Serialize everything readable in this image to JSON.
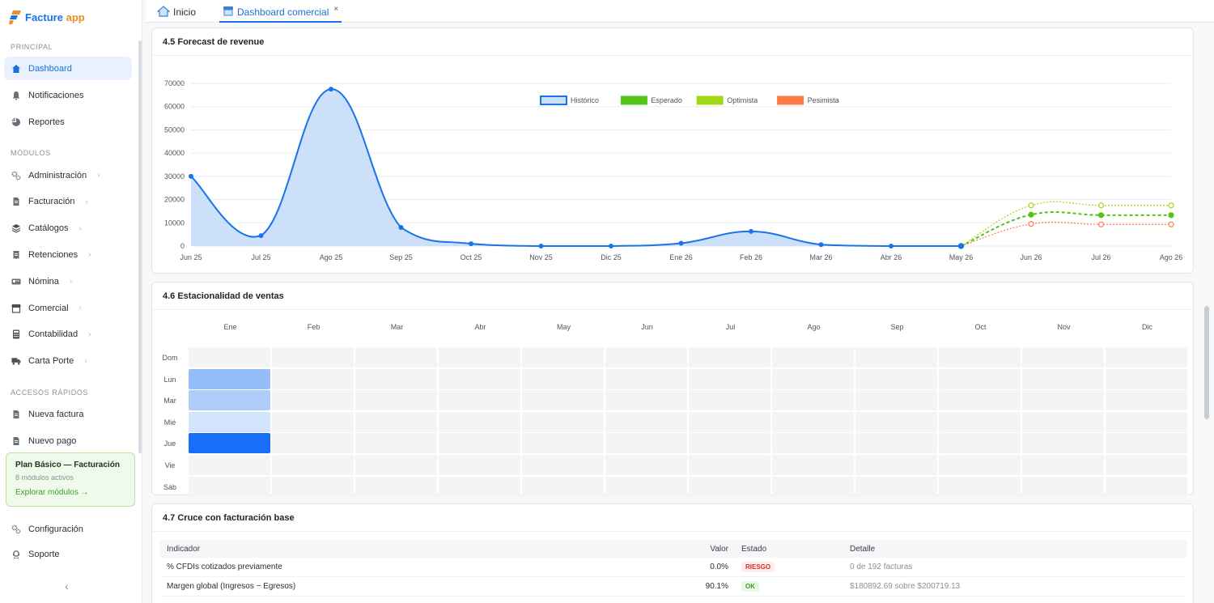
{
  "brand": {
    "name": "Facture",
    "suffix": "app"
  },
  "sidebar": {
    "principal_label": "PRINCIPAL",
    "principal": [
      {
        "label": "Dashboard",
        "icon": "home-icon",
        "active": true
      },
      {
        "label": "Notificaciones",
        "icon": "bell-icon"
      },
      {
        "label": "Reportes",
        "icon": "pie-chart-icon"
      }
    ],
    "modulos_label": "MÓDULOS",
    "modulos": [
      {
        "label": "Administración",
        "icon": "gears-icon"
      },
      {
        "label": "Facturación",
        "icon": "document-icon"
      },
      {
        "label": "Catálogos",
        "icon": "layers-icon"
      },
      {
        "label": "Retenciones",
        "icon": "receipt-icon"
      },
      {
        "label": "Nómina",
        "icon": "id-card-icon"
      },
      {
        "label": "Comercial",
        "icon": "store-icon"
      },
      {
        "label": "Contabilidad",
        "icon": "calculator-icon"
      },
      {
        "label": "Carta Porte",
        "icon": "truck-icon"
      }
    ],
    "accesos_label": "ACCESOS RÁPIDOS",
    "accesos": [
      {
        "label": "Nueva factura",
        "icon": "document-icon"
      },
      {
        "label": "Nuevo pago",
        "icon": "document-icon"
      }
    ],
    "plan": {
      "title": "Plan Básico — Facturación",
      "subtitle": "8 módulos activos",
      "link": "Explorar módulos →"
    },
    "footer": [
      {
        "label": "Configuración",
        "icon": "gears-icon"
      },
      {
        "label": "Soporte",
        "icon": "headset-icon"
      }
    ],
    "collapse_glyph": "‹"
  },
  "tabs": [
    {
      "label": "Inicio",
      "icon": "home-icon"
    },
    {
      "label": "Dashboard comercial",
      "icon": "store-icon",
      "active": true,
      "close": "×"
    }
  ],
  "forecast": {
    "title": "4.5 Forecast de revenue",
    "chart_data": {
      "type": "line",
      "categories": [
        "Jun 25",
        "Jul 25",
        "Ago 25",
        "Sep 25",
        "Oct 25",
        "Nov 25",
        "Dic 25",
        "Ene 26",
        "Feb 26",
        "Mar 26",
        "Abr 26",
        "May 26",
        "Jun 26",
        "Jul 26",
        "Ago 26"
      ],
      "ylim": [
        0,
        70000
      ],
      "yticks": [
        0,
        10000,
        20000,
        30000,
        40000,
        50000,
        60000,
        70000
      ],
      "legend": "top-center",
      "grid": true,
      "series": [
        {
          "name": "Histórico",
          "color": "#1a73e8",
          "fill": "#cce0fa",
          "values": [
            30000,
            4500,
            67500,
            8000,
            1000,
            0,
            0,
            1200,
            6300,
            600,
            0,
            0,
            null,
            null,
            null
          ]
        },
        {
          "name": "Esperado",
          "color": "#52c41a",
          "dash": true,
          "values": [
            null,
            null,
            null,
            null,
            null,
            null,
            null,
            null,
            null,
            null,
            null,
            0,
            13500,
            13300,
            13300
          ]
        },
        {
          "name": "Optimista",
          "color": "#a0d911",
          "dash": true,
          "values": [
            null,
            null,
            null,
            null,
            null,
            null,
            null,
            null,
            null,
            null,
            null,
            0,
            17500,
            17500,
            17500
          ]
        },
        {
          "name": "Pesimista",
          "color": "#ff7a45",
          "dash": true,
          "values": [
            null,
            null,
            null,
            null,
            null,
            null,
            null,
            null,
            null,
            null,
            null,
            0,
            9500,
            9300,
            9300
          ]
        }
      ]
    }
  },
  "seasonality": {
    "title": "4.6 Estacionalidad de ventas",
    "chart_data": {
      "type": "heatmap",
      "months": [
        "Ene",
        "Feb",
        "Mar",
        "Abr",
        "May",
        "Jun",
        "Jul",
        "Ago",
        "Sep",
        "Oct",
        "Nov",
        "Dic"
      ],
      "days": [
        "Dom",
        "Lun",
        "Mar",
        "Mié",
        "Jue",
        "Vie",
        "Sáb"
      ],
      "values": [
        [
          0,
          0,
          0,
          0,
          0,
          0,
          0,
          0,
          0,
          0,
          0,
          0
        ],
        [
          0.4,
          0,
          0,
          0,
          0,
          0,
          0,
          0,
          0,
          0,
          0,
          0
        ],
        [
          0.28,
          0,
          0,
          0,
          0,
          0,
          0,
          0,
          0,
          0,
          0,
          0
        ],
        [
          0.1,
          0,
          0,
          0,
          0,
          0,
          0,
          0,
          0,
          0,
          0,
          0
        ],
        [
          1,
          0,
          0,
          0,
          0,
          0,
          0,
          0,
          0,
          0,
          0,
          0
        ],
        [
          0,
          0,
          0,
          0,
          0,
          0,
          0,
          0,
          0,
          0,
          0,
          0
        ],
        [
          0,
          0,
          0,
          0,
          0,
          0,
          0,
          0,
          0,
          0,
          0,
          0
        ]
      ]
    }
  },
  "cruce": {
    "title": "4.7 Cruce con facturación base",
    "headers": {
      "indicador": "Indicador",
      "valor": "Valor",
      "estado": "Estado",
      "detalle": "Detalle"
    },
    "rows": [
      {
        "indicador": "% CFDIs cotizados previamente",
        "valor": "0.0%",
        "estado": "RIESGO",
        "estado_kind": "riesgo",
        "detalle": "0 de 192 facturas"
      },
      {
        "indicador": "Margen global (Ingresos − Egresos)",
        "valor": "90.1%",
        "estado": "OK",
        "estado_kind": "ok",
        "detalle": "$180892.69 sobre $200719.13"
      }
    ]
  }
}
